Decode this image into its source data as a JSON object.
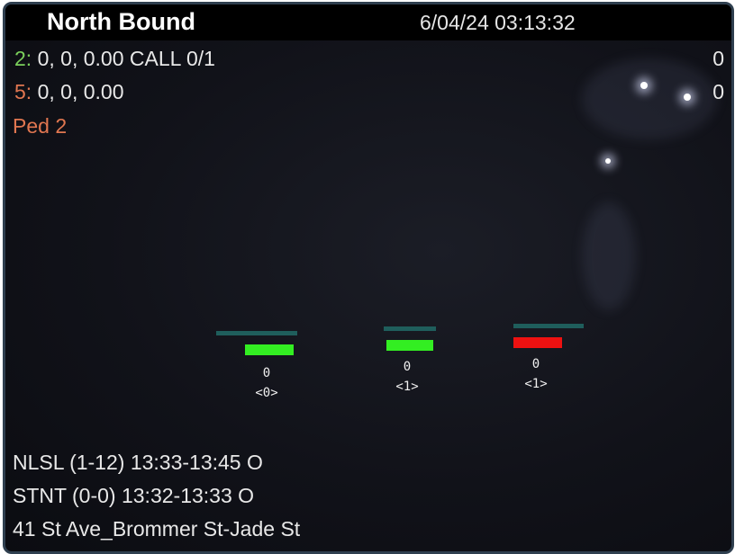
{
  "header": {
    "title": "North Bound",
    "timestamp": "6/04/24 03:13:32",
    "mode_icon": "moon-icon"
  },
  "phases": [
    {
      "num": "2",
      "sep": ":",
      "text": " 0, 0, 0.00 CALL 0/1",
      "count": "0",
      "color": "#7bd05c"
    },
    {
      "num": "5",
      "sep": ":",
      "text": " 0, 0, 0.00",
      "count": "0",
      "color": "#e07650"
    }
  ],
  "ped": {
    "label": "Ped 2",
    "color": "#e07650"
  },
  "lanes": [
    {
      "occupancy": "0",
      "zone": "<0>",
      "signal_color": "#33ee22"
    },
    {
      "occupancy": "0",
      "zone": "<1>",
      "signal_color": "#33ee22"
    },
    {
      "occupancy": "0",
      "zone": "<1>",
      "signal_color": "#ee1111"
    }
  ],
  "footer": {
    "line1": "NLSL (1-12) 13:33-13:45 O",
    "line2": "STNT (0-0) 13:32-13:33 O",
    "location": "41 St Ave_Brommer St-Jade St"
  }
}
